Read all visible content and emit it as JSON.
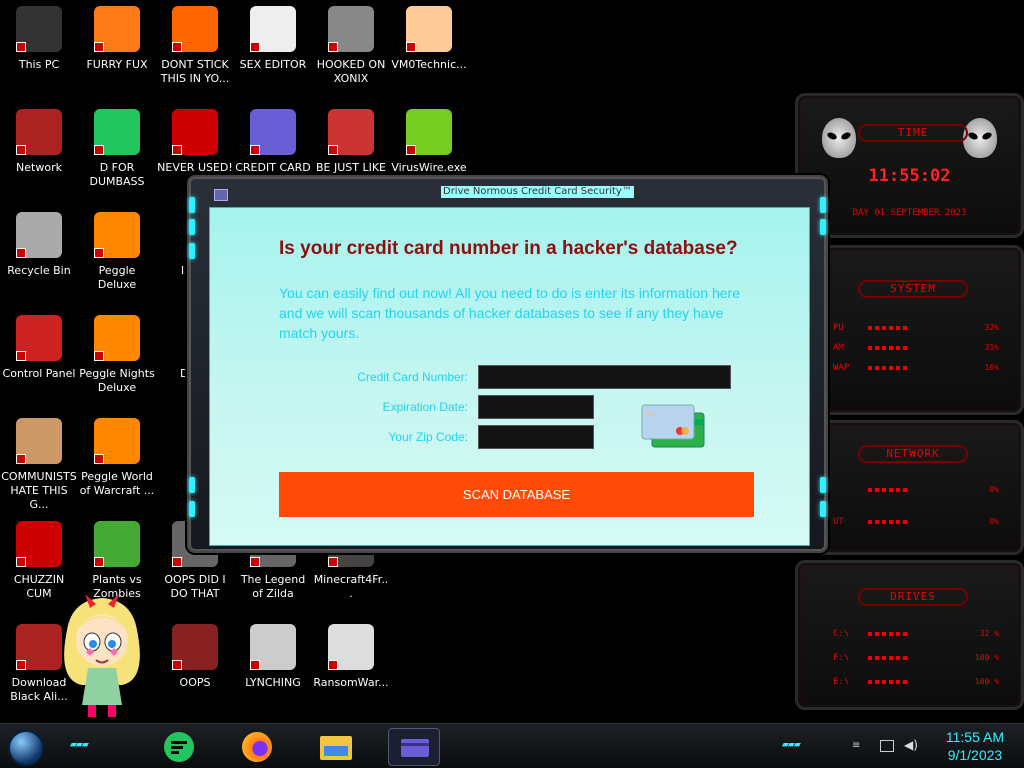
{
  "desktop": {
    "icons": [
      {
        "label": "This PC"
      },
      {
        "label": "FURRY FUX"
      },
      {
        "label": "DONT STICK THIS IN YO..."
      },
      {
        "label": "SEX EDITOR"
      },
      {
        "label": "HOOKED ON XONIX"
      },
      {
        "label": "VM0Technic..."
      },
      {
        "label": "Network"
      },
      {
        "label": "D FOR DUMBASS"
      },
      {
        "label": "NEVER USED!"
      },
      {
        "label": "CREDIT CARD"
      },
      {
        "label": "BE JUST LIKE"
      },
      {
        "label": "VirusWire.exe"
      },
      {
        "label": "Recycle Bin"
      },
      {
        "label": "Peggle Deluxe"
      },
      {
        "label": "ISRAI"
      },
      {
        "label": "Control Panel"
      },
      {
        "label": "Peggle Nights Deluxe"
      },
      {
        "label": "DEEZ"
      },
      {
        "label": "COMMUNISTS HATE THIS G..."
      },
      {
        "label": "Peggle World of Warcraft ..."
      },
      {
        "label": "DIE"
      },
      {
        "label": "CHUZZIN CUM"
      },
      {
        "label": "Plants vs Zombies"
      },
      {
        "label": "OOPS DID I DO THAT"
      },
      {
        "label": "The Legend of Zilda"
      },
      {
        "label": "Minecraft4Fr..."
      },
      {
        "label": "Download Black Ali..."
      },
      {
        "label": "OOPS"
      },
      {
        "label": "LYNCHING"
      },
      {
        "label": "RansomWar..."
      }
    ]
  },
  "widgets": {
    "time": {
      "title": "TIME",
      "clock": "11:55:02",
      "date": "DAY 01 SEPTEMBER 2023"
    },
    "system": {
      "title": "SYSTEM",
      "rows": [
        {
          "label": "PU",
          "value": "32%"
        },
        {
          "label": "AM",
          "value": "31%"
        },
        {
          "label": "WAP",
          "value": "16%"
        }
      ]
    },
    "network": {
      "title": "NETWORK",
      "rows": [
        {
          "label": "",
          "value": "0%"
        },
        {
          "label": "UT",
          "value": "0%"
        }
      ]
    },
    "drives": {
      "title": "DRIVES",
      "rows": [
        {
          "label": "C:\\",
          "value": "32 %"
        },
        {
          "label": "F:\\",
          "value": "100 %"
        },
        {
          "label": "E:\\",
          "value": "100 %"
        }
      ]
    }
  },
  "dialog": {
    "title": "Drive Normous Credit Card Security™",
    "heading": "Is your credit card number in a hacker's database?",
    "intro": "You can easily find out now! All you need to do is enter its information here and we will scan thousands of hacker databases to see if any they have match yours.",
    "fields": {
      "card_number_label": "Credit Card Number:",
      "card_number_value": "",
      "expiration_label": "Expiration Date:",
      "expiration_value": "",
      "zip_label": "Your Zip Code:",
      "zip_value": ""
    },
    "scan_button": "SCAN DATABASE"
  },
  "taskbar": {
    "clock_time": "11:55 AM",
    "clock_date": "9/1/2023"
  },
  "colors": {
    "accent": "#ff4a08",
    "heading": "#8b1010",
    "cyan_text": "#22d4f0",
    "widget_red": "#e00000"
  }
}
